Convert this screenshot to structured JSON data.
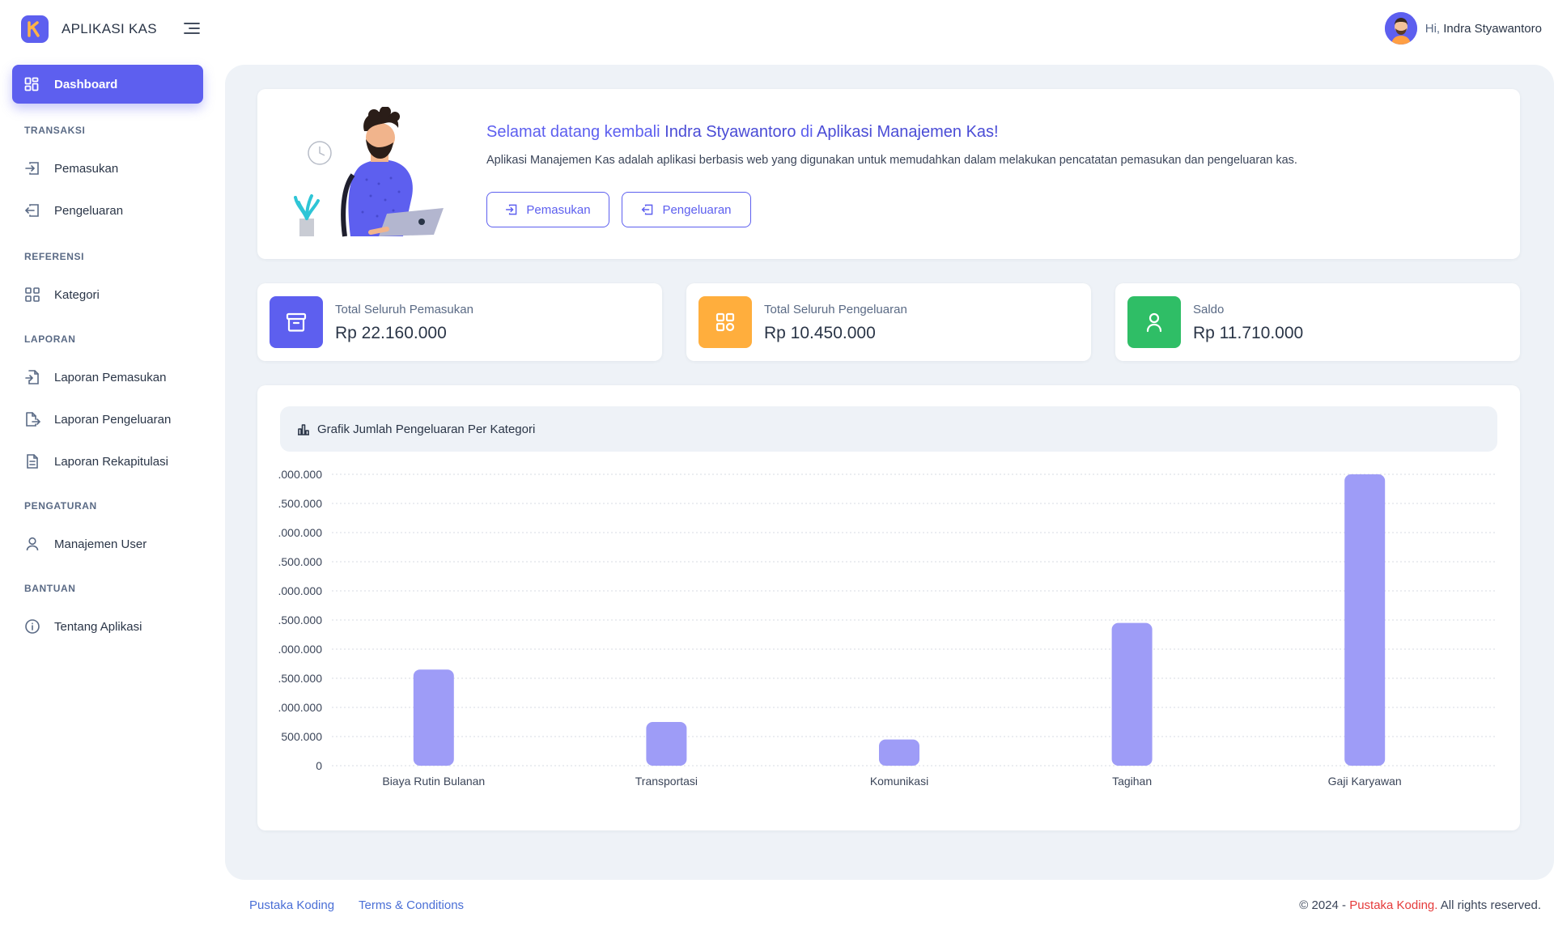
{
  "app": {
    "title": "APLIKASI KAS",
    "logo_letter": "K"
  },
  "header": {
    "greeting_prefix": "Hi, ",
    "user_name": "Indra Styawantoro"
  },
  "sidebar": {
    "active": {
      "label": "Dashboard",
      "icon": "dashboard-icon"
    },
    "sections": [
      {
        "title": "TRANSAKSI",
        "items": [
          {
            "label": "Pemasukan",
            "icon": "login-icon"
          },
          {
            "label": "Pengeluaran",
            "icon": "logout-icon"
          }
        ]
      },
      {
        "title": "REFERENSI",
        "items": [
          {
            "label": "Kategori",
            "icon": "category-icon"
          }
        ]
      },
      {
        "title": "LAPORAN",
        "items": [
          {
            "label": "Laporan Pemasukan",
            "icon": "file-import-icon"
          },
          {
            "label": "Laporan Pengeluaran",
            "icon": "file-export-icon"
          },
          {
            "label": "Laporan Rekapitulasi",
            "icon": "file-text-icon"
          }
        ]
      },
      {
        "title": "PENGATURAN",
        "items": [
          {
            "label": "Manajemen User",
            "icon": "user-icon"
          }
        ]
      },
      {
        "title": "BANTUAN",
        "items": [
          {
            "label": "Tentang Aplikasi",
            "icon": "info-icon"
          }
        ]
      }
    ]
  },
  "welcome": {
    "title_prefix": "Selamat datang kembali ",
    "title_name": "Indra Styawantoro",
    "title_mid": " di ",
    "title_app": "Aplikasi Manajemen Kas!",
    "description": "Aplikasi Manajemen Kas adalah aplikasi berbasis web yang digunakan untuk memudahkan dalam melakukan pencatatan pemasukan dan pengeluaran kas.",
    "btn_income": "Pemasukan",
    "btn_expense": "Pengeluaran"
  },
  "stats": [
    {
      "label": "Total Seluruh Pemasukan",
      "value": "Rp 22.160.000",
      "color": "#5d5fef",
      "icon": "archive-icon"
    },
    {
      "label": "Total Seluruh Pengeluaran",
      "value": "Rp 10.450.000",
      "color": "#ffae3d",
      "icon": "grid-icon"
    },
    {
      "label": "Saldo",
      "value": "Rp 11.710.000",
      "color": "#2fbe66",
      "icon": "user-icon"
    }
  ],
  "chart_title": "Grafik Jumlah Pengeluaran Per Kategori",
  "chart_data": {
    "type": "bar",
    "title": "Grafik Jumlah Pengeluaran Per Kategori",
    "categories": [
      "Biaya Rutin Bulanan",
      "Transportasi",
      "Komunikasi",
      "Tagihan",
      "Gaji Karyawan"
    ],
    "values": [
      1650000,
      750000,
      450000,
      2450000,
      5000000
    ],
    "ylim": [
      0,
      5000000
    ],
    "yticks": [
      "0",
      "500.000",
      ".000.000",
      ".500.000",
      ".000.000",
      ".500.000",
      ".000.000",
      ".500.000",
      ".000.000",
      ".500.000",
      ".000.000"
    ],
    "bar_color": "#9e9cf7",
    "grid": true
  },
  "footer": {
    "link1": "Pustaka Koding",
    "link2": "Terms & Conditions",
    "copy_prefix": "© 2024 - ",
    "copy_brand": "Pustaka Koding.",
    "copy_suffix": " All rights reserved."
  }
}
